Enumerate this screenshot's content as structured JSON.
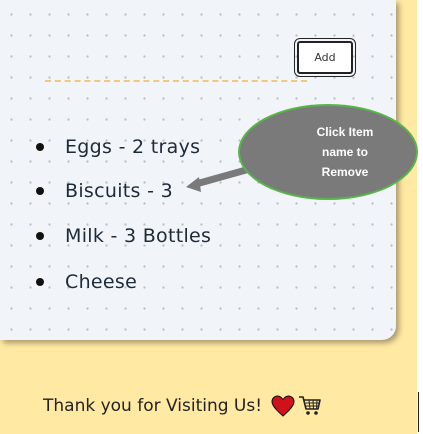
{
  "form": {
    "add_label": "Add"
  },
  "list": {
    "items": [
      {
        "label": "Eggs - 2 trays"
      },
      {
        "label": "Biscuits - 3"
      },
      {
        "label": "Milk - 3 Bottles"
      },
      {
        "label": "Cheese"
      }
    ]
  },
  "hint": {
    "text": "Click Item name to Remove"
  },
  "footer": {
    "thanks": "Thank you for Visiting Us!",
    "icons": [
      "heart-icon",
      "shopping-cart-icon"
    ]
  },
  "colors": {
    "background": "#ffe9a3",
    "card": "#f1f4f8",
    "hint_bubble": "#7a7a7a",
    "hint_border": "#58b648",
    "heart": "#d0111a"
  }
}
